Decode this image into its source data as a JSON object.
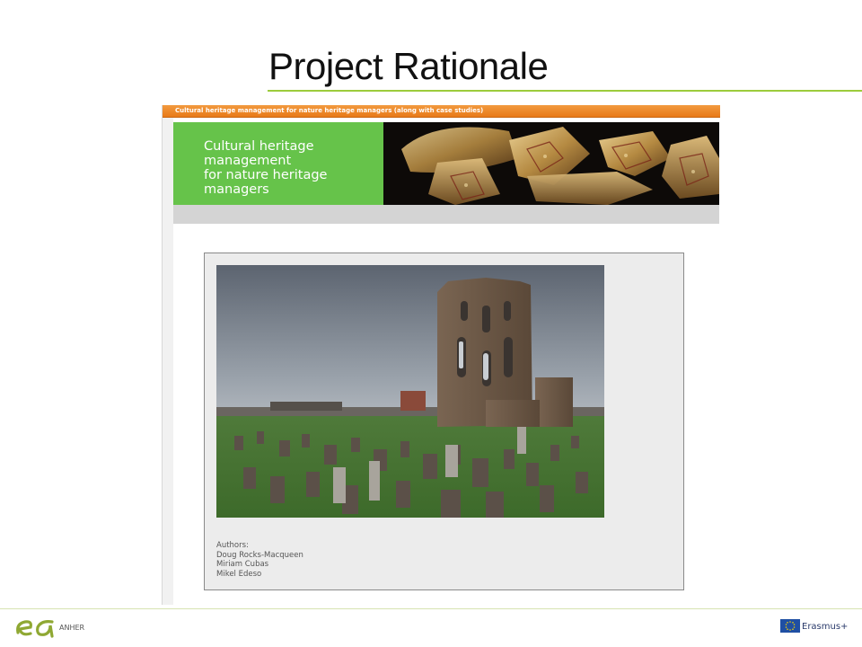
{
  "slide": {
    "title": "Project Rationale"
  },
  "screenshot": {
    "header_text": "Cultural heritage management for nature heritage managers (along with case studies)",
    "banner_lines": [
      "Cultural heritage",
      "management",
      "for nature heritage",
      "managers"
    ],
    "authors": [
      "Authors:",
      "Doug Rocks-Macqueen",
      "Miriam Cubas",
      "Mikel Edeso"
    ]
  },
  "footer": {
    "brand": "ANHER",
    "program": "Erasmus+"
  },
  "colors": {
    "accent_green": "#9ccc3c",
    "banner_green": "#66c34a",
    "header_orange": "#e87a18",
    "eu_blue": "#1f4fa3"
  },
  "icons": {
    "footer_logo": "anher-logo-icon",
    "eu_flag": "eu-flag-icon"
  }
}
